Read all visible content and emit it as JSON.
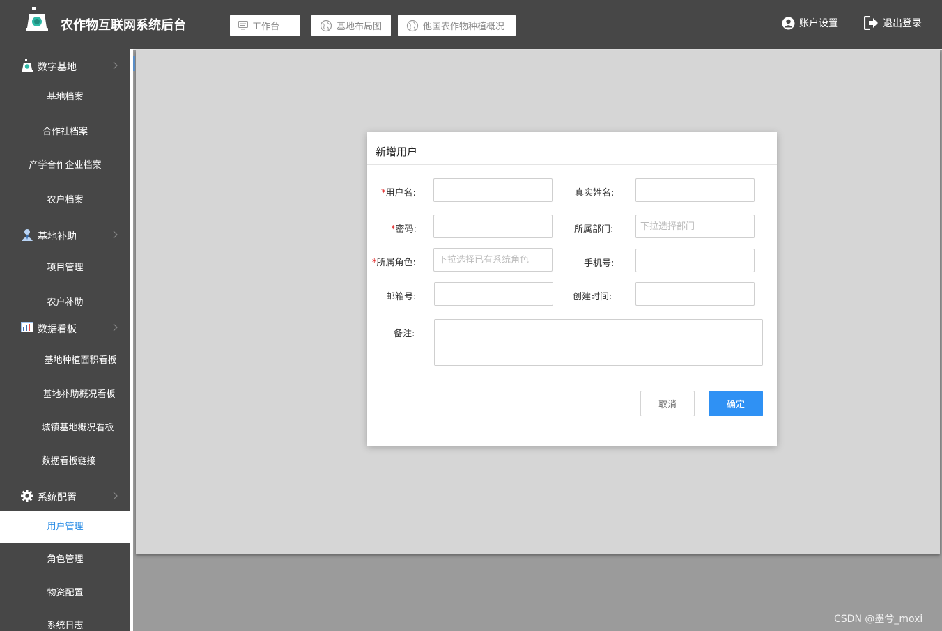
{
  "header": {
    "app_title": "农作物互联网系统后台",
    "nav": [
      {
        "label": "工作台",
        "icon": "monitor-icon"
      },
      {
        "label": "基地布局图",
        "icon": "globe-icon"
      },
      {
        "label": "他国农作物种植概况",
        "icon": "globe-icon"
      }
    ],
    "account_label": "账户设置",
    "logout_label": "退出登录"
  },
  "sidebar": {
    "groups": [
      {
        "label": "数字基地",
        "icon": "base-icon",
        "items": [
          "基地档案",
          "合作社档案",
          "产学合作企业档案",
          "农户档案"
        ]
      },
      {
        "label": "基地补助",
        "icon": "user-icon",
        "items": [
          "项目管理",
          "农户补助"
        ]
      },
      {
        "label": "数据看板",
        "icon": "bar-chart-icon",
        "items": [
          "基地种植面积看板",
          "基地补助概况看板",
          "城镇基地概况看板",
          "数据看板链接"
        ]
      },
      {
        "label": "系统配置",
        "icon": "gear-icon",
        "items": [
          "用户管理",
          "角色管理",
          "物资配置",
          "系统日志"
        ]
      }
    ],
    "active_item": "用户管理"
  },
  "dialog": {
    "title": "新增用户",
    "fields": {
      "username": {
        "label": "用户名:",
        "required": true,
        "placeholder": "",
        "value": ""
      },
      "realname": {
        "label": "真实姓名:",
        "required": false,
        "placeholder": "",
        "value": ""
      },
      "password": {
        "label": "密码:",
        "required": true,
        "placeholder": "",
        "value": ""
      },
      "department": {
        "label": "所属部门:",
        "required": false,
        "placeholder": "下拉选择部门",
        "value": ""
      },
      "role": {
        "label": "所属角色:",
        "required": true,
        "placeholder": "下拉选择已有系统角色",
        "value": ""
      },
      "phone": {
        "label": "手机号:",
        "required": false,
        "placeholder": "",
        "value": ""
      },
      "email": {
        "label": "邮箱号:",
        "required": false,
        "placeholder": "",
        "value": ""
      },
      "created_at": {
        "label": "创建时间:",
        "required": false,
        "placeholder": "",
        "value": ""
      },
      "remark": {
        "label": "备注:",
        "required": false,
        "placeholder": "",
        "value": ""
      }
    },
    "cancel_label": "取消",
    "ok_label": "确定"
  },
  "watermark": "CSDN @墨兮_moxi",
  "colors": {
    "header_bg": "#474747",
    "accent": "#2f91f4",
    "active_text": "#2b8de6",
    "required": "#e02020"
  }
}
